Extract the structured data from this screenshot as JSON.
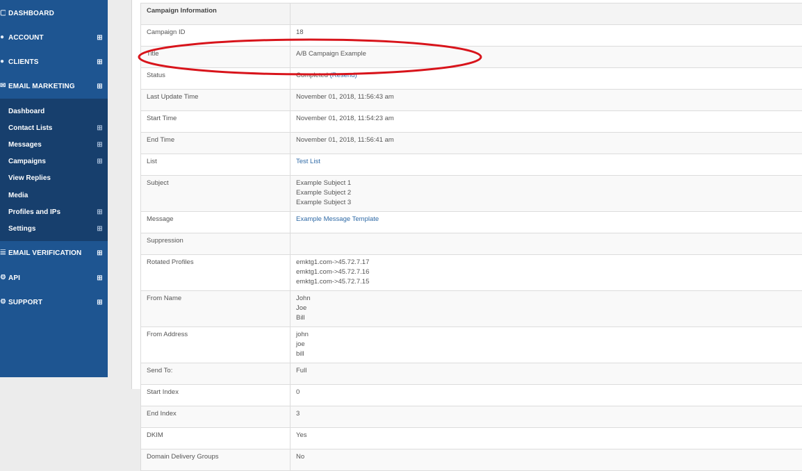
{
  "sidebar": {
    "main_top": [
      {
        "label": "DASHBOARD",
        "icon": "monitor-icon",
        "expandable": false
      },
      {
        "label": "ACCOUNT",
        "icon": "user-icon",
        "expandable": true
      },
      {
        "label": "CLIENTS",
        "icon": "users-icon",
        "expandable": true
      },
      {
        "label": "EMAIL MARKETING",
        "icon": "envelope-icon",
        "expandable": true
      }
    ],
    "email_marketing_sub": [
      {
        "label": "Dashboard",
        "expandable": false
      },
      {
        "label": "Contact Lists",
        "expandable": true
      },
      {
        "label": "Messages",
        "expandable": true
      },
      {
        "label": "Campaigns",
        "expandable": true
      },
      {
        "label": "View Replies",
        "expandable": false
      },
      {
        "label": "Media",
        "expandable": false
      },
      {
        "label": "Profiles and IPs",
        "expandable": true
      },
      {
        "label": "Settings",
        "expandable": true
      }
    ],
    "main_bottom": [
      {
        "label": "EMAIL VERIFICATION",
        "icon": "checklist-icon",
        "expandable": true
      },
      {
        "label": "API",
        "icon": "gears-icon",
        "expandable": true
      },
      {
        "label": "SUPPORT",
        "icon": "wrench-icon",
        "expandable": true
      }
    ],
    "colors": {
      "background": "#1e5591",
      "submenu_background": "#173f6d"
    }
  },
  "campaign_table": {
    "header": "Campaign Information",
    "rows": [
      {
        "label": "Campaign ID",
        "lines": [
          "18"
        ]
      },
      {
        "label": "Title",
        "lines": [
          "A/B Campaign Example"
        ]
      },
      {
        "label": "Status",
        "value": "Completed",
        "link": "(Resend)"
      },
      {
        "label": "Last Update Time",
        "lines": [
          "November 01, 2018, 11:56:43 am"
        ]
      },
      {
        "label": "Start Time",
        "lines": [
          "November 01, 2018, 11:54:23 am"
        ]
      },
      {
        "label": "End Time",
        "lines": [
          "November 01, 2018, 11:56:41 am"
        ]
      },
      {
        "label": "List",
        "link": "Test List"
      },
      {
        "label": "Subject",
        "lines": [
          "Example Subject 1",
          "Example Subject 2",
          "Example Subject 3"
        ]
      },
      {
        "label": "Message",
        "link": "Example Message Template"
      },
      {
        "label": "Suppression",
        "lines": [
          ""
        ]
      },
      {
        "label": "Rotated Profiles",
        "lines": [
          "emktg1.com->45.72.7.17",
          "emktg1.com->45.72.7.16",
          "emktg1.com->45.72.7.15"
        ]
      },
      {
        "label": "From Name",
        "lines": [
          "John",
          "Joe",
          "Bill"
        ]
      },
      {
        "label": "From Address",
        "lines": [
          "john",
          "joe",
          "bill"
        ]
      },
      {
        "label": "Send To:",
        "lines": [
          "Full"
        ]
      },
      {
        "label": "Start Index",
        "lines": [
          "0"
        ]
      },
      {
        "label": "End Index",
        "lines": [
          "3"
        ]
      },
      {
        "label": "DKIM",
        "lines": [
          "Yes"
        ]
      },
      {
        "label": "Domain Delivery Groups",
        "lines": [
          "No"
        ]
      }
    ]
  },
  "annotation": {
    "shape": "ellipse",
    "color": "#d8141b",
    "highlights": "Status"
  },
  "colors": {
    "link": "#2f6aa6",
    "content_background": "#ececec"
  }
}
